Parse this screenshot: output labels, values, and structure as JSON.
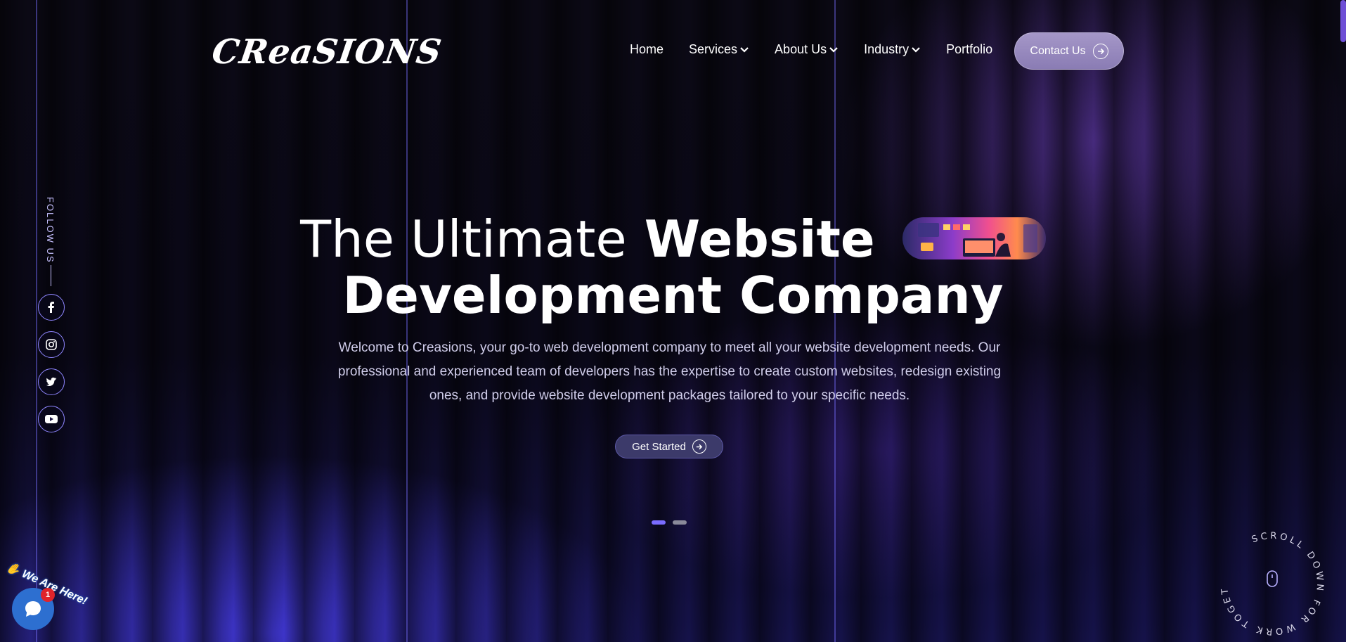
{
  "header": {
    "logo_text": "CReaSIONS",
    "nav": [
      {
        "label": "Home",
        "has_dropdown": false
      },
      {
        "label": "Services",
        "has_dropdown": true
      },
      {
        "label": "About Us",
        "has_dropdown": true
      },
      {
        "label": "Industry",
        "has_dropdown": true
      },
      {
        "label": "Portfolio",
        "has_dropdown": false
      }
    ],
    "contact_label": "Contact Us"
  },
  "sidebar": {
    "follow_label": "FOLLOW US",
    "socials": [
      "facebook-icon",
      "instagram-icon",
      "twitter-icon",
      "youtube-icon"
    ]
  },
  "hero": {
    "title_part1": "The Ultimate",
    "title_part2": "Website",
    "title_line2": "Development Company",
    "description": "Welcome to Creasions, your go-to web development company to meet all your website development needs. Our professional and experienced team of developers has the expertise to create custom websites, redesign existing ones, and provide website development packages tailored to your specific needs.",
    "cta_label": "Get Started",
    "slides_total": 2,
    "active_slide": 1
  },
  "scroll_badge": {
    "text": "SCROLL DOWN FOR WORK TOGETHER"
  },
  "chat": {
    "label": "We Are Here!",
    "unread_count": "1"
  },
  "colors": {
    "accent": "#7a6cff",
    "contact_bg": "#9a8cc3",
    "chat_blue": "#2d6fd0"
  }
}
